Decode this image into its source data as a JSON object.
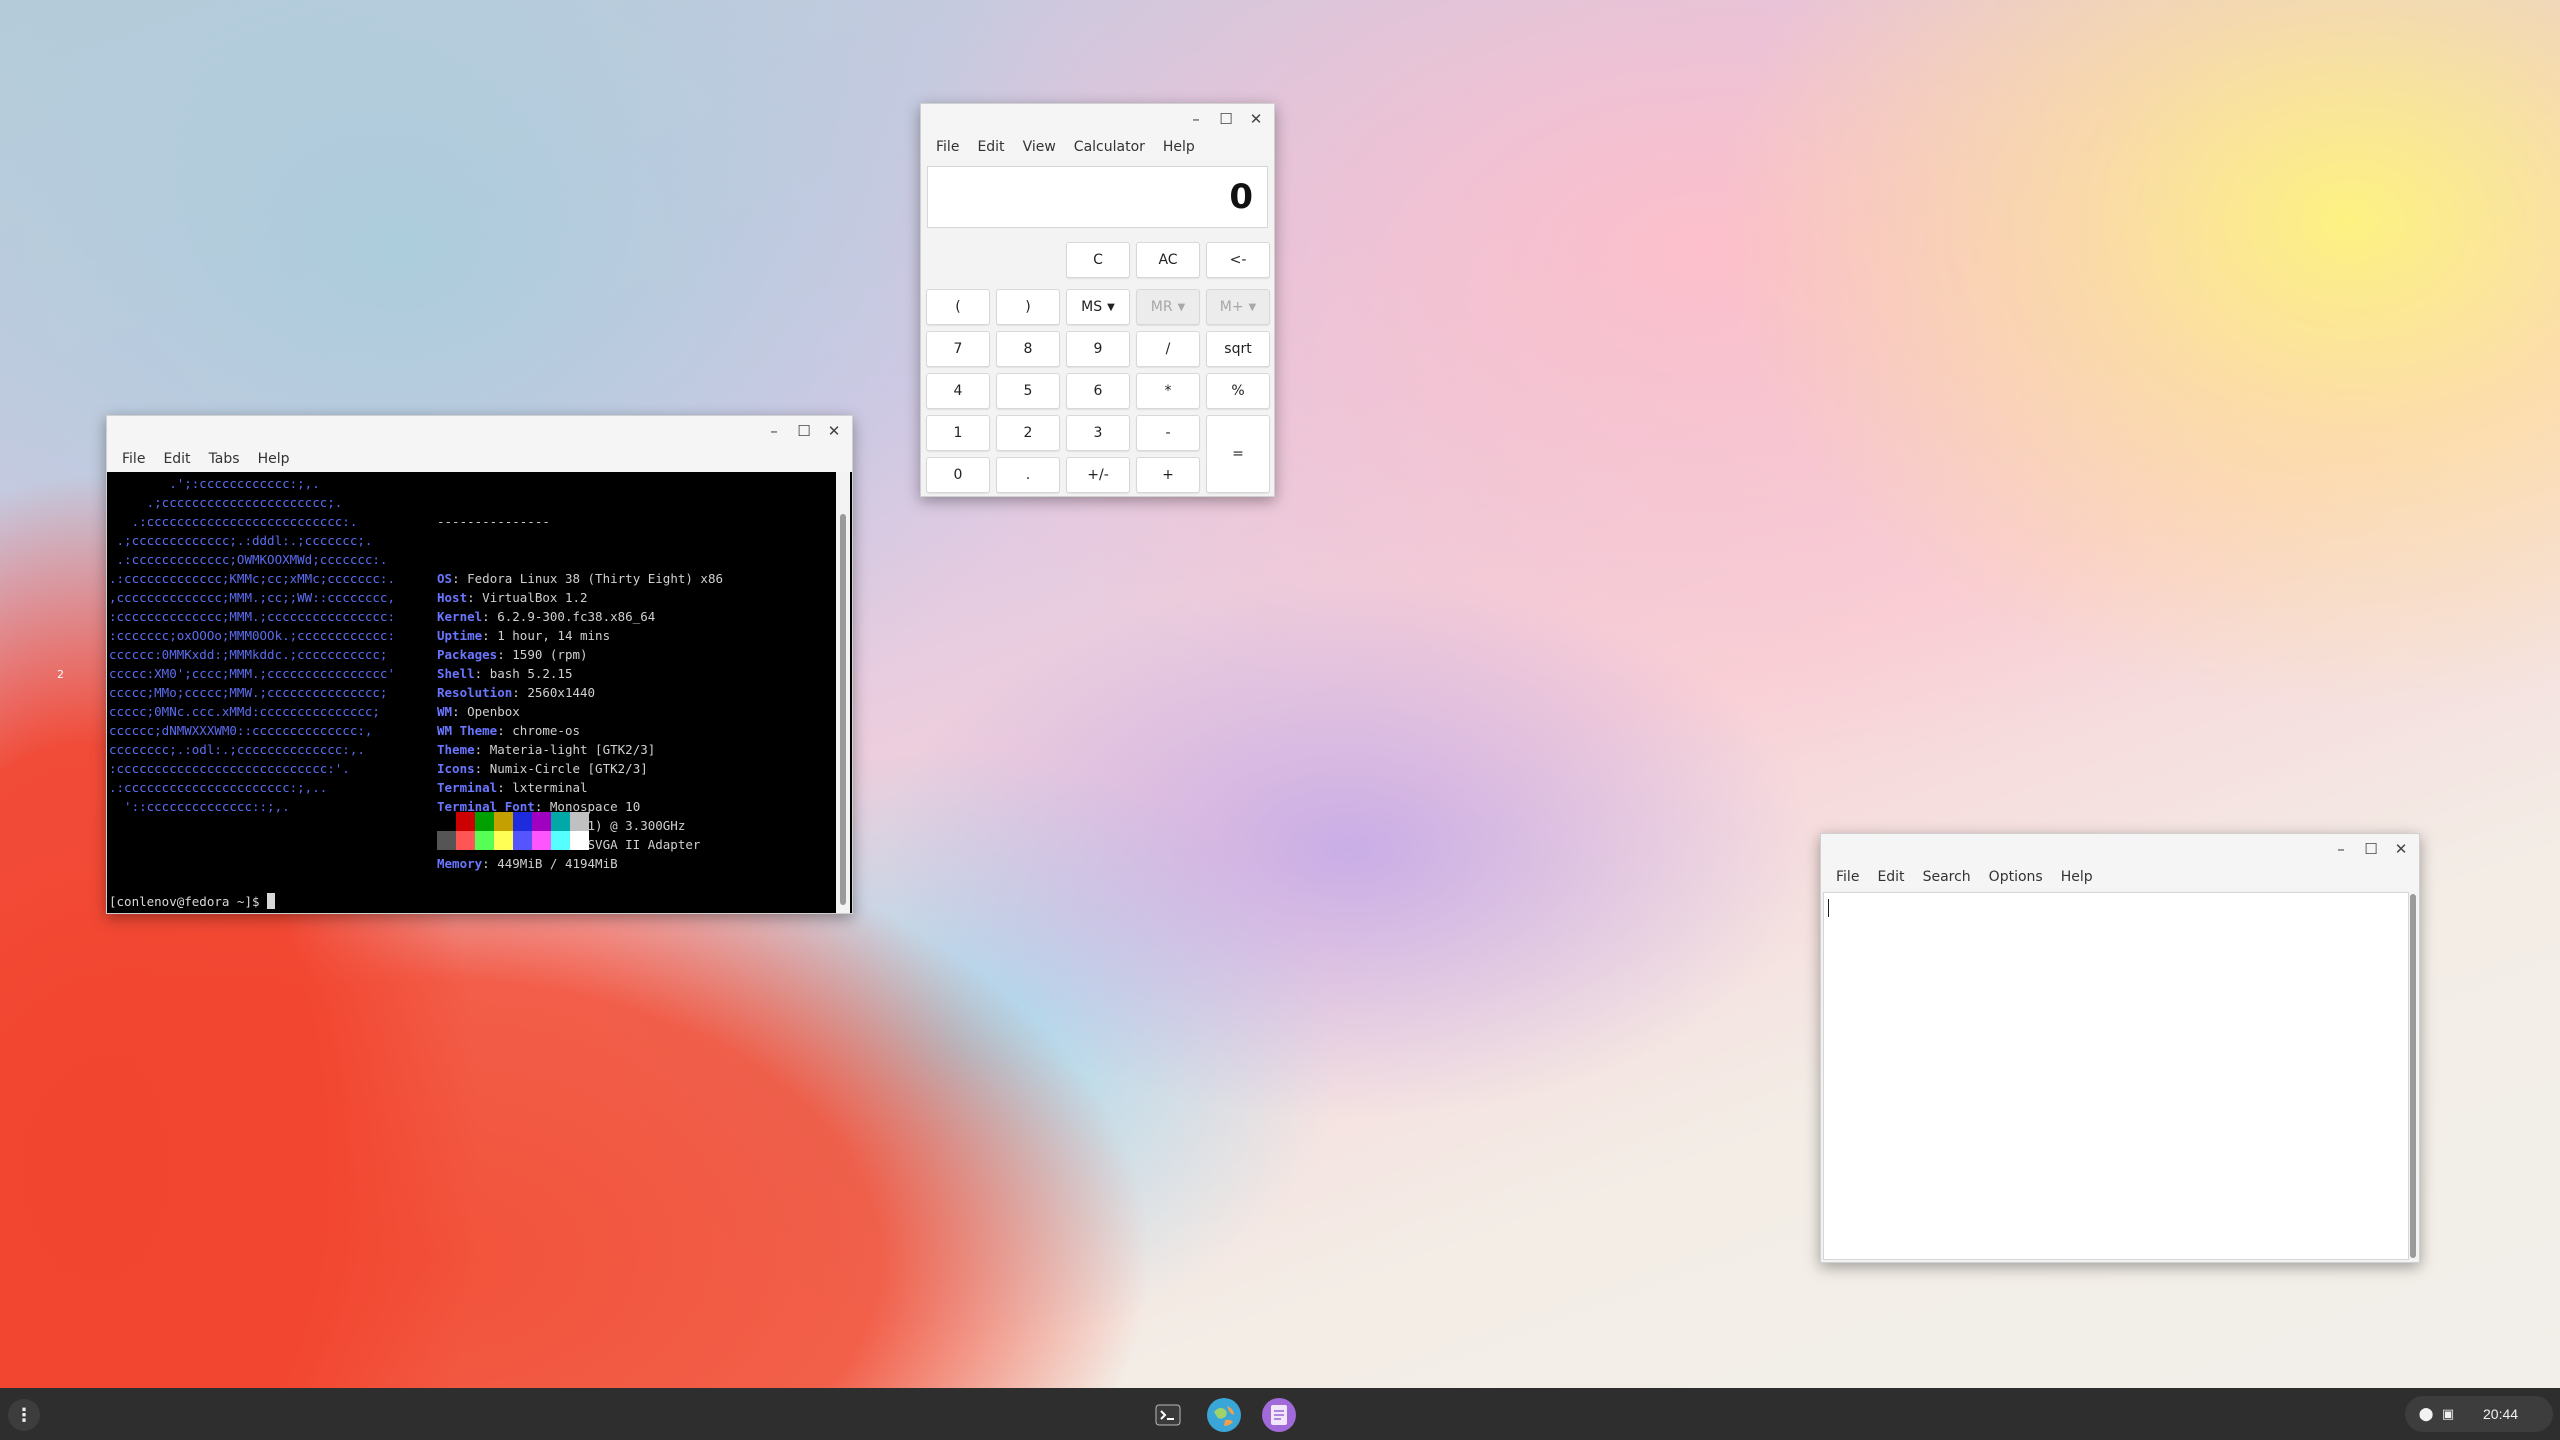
{
  "terminal": {
    "menu": [
      "File",
      "Edit",
      "Tabs",
      "Help"
    ],
    "logo_lines": [
      "        .';:cccccccccccc:;,.",
      "     .;cccccccccccccccccccccc;.",
      "   .:cccccccccccccccccccccccccc:.",
      " .;ccccccccccccc;.:dddl:.;ccccccc;.",
      " .:ccccccccccccc;OWMKOOXMWd;ccccccc:.",
      ".:ccccccccccccc;KMMc;cc;xMMc;ccccccc:.",
      ",cccccccccccccc;MMM.;cc;;WW::cccccccc,",
      ":cccccccccccccc;MMM.;cccccccccccccccc:",
      ":ccccccc;oxOOOo;MMM0OOk.;cccccccccccc:",
      "cccccc:0MMKxdd:;MMMkddc.;ccccccccccc;",
      "ccccc:XM0';cccc;MMM.;cccccccccccccccc'",
      "ccccc;MMo;ccccc;MMW.;ccccccccccccccc;",
      "ccccc;0MNc.ccc.xMMd:ccccccccccccccc;",
      "cccccc;dNMWXXXWM0::cccccccccccccc:,",
      "cccccccc;.:odl:.;cccccccccccccc:,.",
      ":cccccccccccccccccccccccccccc:'.",
      ".:cccccccccccccccccccccc:;,..",
      "  '::cccccccccccccc::;,."
    ],
    "header_line": "---------------",
    "info": [
      {
        "key": "OS",
        "value": "Fedora Linux 38 (Thirty Eight) x86"
      },
      {
        "key": "Host",
        "value": "VirtualBox 1.2"
      },
      {
        "key": "Kernel",
        "value": "6.2.9-300.fc38.x86_64"
      },
      {
        "key": "Uptime",
        "value": "1 hour, 14 mins"
      },
      {
        "key": "Packages",
        "value": "1590 (rpm)"
      },
      {
        "key": "Shell",
        "value": "bash 5.2.15"
      },
      {
        "key": "Resolution",
        "value": "2560x1440"
      },
      {
        "key": "WM",
        "value": "Openbox"
      },
      {
        "key": "WM Theme",
        "value": "chrome-os"
      },
      {
        "key": "Theme",
        "value": "Materia-light [GTK2/3]"
      },
      {
        "key": "Icons",
        "value": "Numix-Circle [GTK2/3]"
      },
      {
        "key": "Terminal",
        "value": "lxterminal"
      },
      {
        "key": "Terminal Font",
        "value": "Monospace 10"
      },
      {
        "key": "CPU",
        "value": "Intel i5-2500 (1) @ 3.300GHz"
      },
      {
        "key": "GPU",
        "value": "00:02.0 VMware SVGA II Adapter"
      },
      {
        "key": "Memory",
        "value": "449MiB / 4194MiB"
      }
    ],
    "palette_top": [
      "#000000",
      "#cc0000",
      "#00a000",
      "#c4a000",
      "#1e2bdc",
      "#a000c0",
      "#00a8a8",
      "#c0c0c0"
    ],
    "palette_bottom": [
      "#555555",
      "#ff5555",
      "#55ff55",
      "#ffff55",
      "#5555ff",
      "#ff55ff",
      "#55ffff",
      "#ffffff"
    ],
    "prompt": "[conlenov@fedora ~]$ "
  },
  "calculator": {
    "menu": [
      "File",
      "Edit",
      "View",
      "Calculator",
      "Help"
    ],
    "display": "0",
    "buttons": {
      "clear": "C",
      "all_clear": "AC",
      "backspace": "<-",
      "lparen": "(",
      "rparen": ")",
      "ms": "MS",
      "mr": "MR",
      "mplus": "M+",
      "b7": "7",
      "b8": "8",
      "b9": "9",
      "div": "/",
      "sqrt": "sqrt",
      "b4": "4",
      "b5": "5",
      "b6": "6",
      "mul": "*",
      "pct": "%",
      "b1": "1",
      "b2": "2",
      "b3": "3",
      "sub": "-",
      "eq": "=",
      "b0": "0",
      "dot": ".",
      "neg": "+/-",
      "add": "+"
    }
  },
  "editor": {
    "menu": [
      "File",
      "Edit",
      "Search",
      "Options",
      "Help"
    ],
    "content": ""
  },
  "desktop": {
    "mark": "2"
  },
  "taskbar": {
    "launcher_glyph": "⋮",
    "clock": "20:44",
    "apps": [
      "terminal-icon",
      "browser-icon",
      "text-editor-icon"
    ]
  }
}
